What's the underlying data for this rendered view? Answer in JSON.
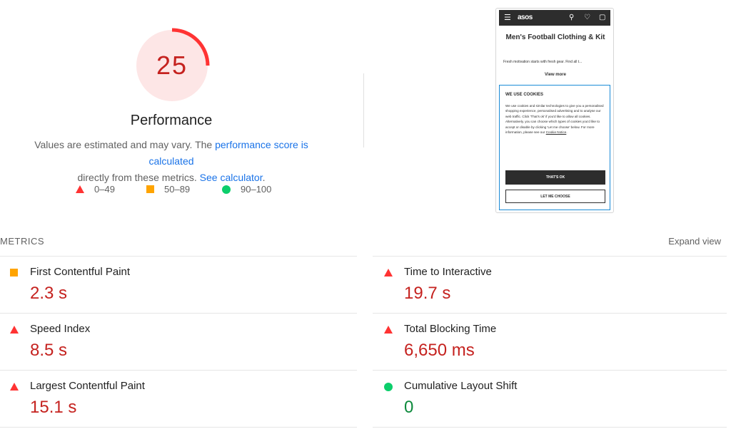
{
  "score": {
    "value": "25",
    "fraction": 0.25,
    "color": "#ff3333",
    "bg": "#fde6e6"
  },
  "performance": {
    "title": "Performance",
    "desc_pre": "Values are estimated and may vary. The ",
    "desc_link1": "performance score is calculated",
    "desc_mid": "directly from these metrics. ",
    "desc_link2": "See calculator",
    "desc_post": "."
  },
  "legend": [
    {
      "shape": "triangle",
      "color": "#ff3333",
      "label": "0–49"
    },
    {
      "shape": "square",
      "color": "#ffa400",
      "label": "50–89"
    },
    {
      "shape": "circle",
      "color": "#0cce6b",
      "label": "90–100"
    }
  ],
  "screenshot": {
    "menu_icon": "☰",
    "logo": "asos",
    "search_icon": "⚲",
    "heart_icon": "♡",
    "bag_icon": "▢",
    "page_title": "Men's Football Clothing & Kit",
    "subtitle": "Fresh motivation starts with fresh gear. Find all t...",
    "view_more": "View more",
    "cookie_heading": "WE USE COOKIES",
    "cookie_body": "We use cookies and similar technologies to give you a personalised shopping experience, personalised advertising and to analyse our web traffic. Click 'That's ok' if you'd like to allow all cookies. Alternatively, you can choose which types of cookies you'd like to accept or disable by clicking 'Let me choose' below. For more information, please see our ",
    "cookie_link": "Cookie Notice",
    "cookie_end": ".",
    "ok_button": "THAT'S OK",
    "choose_button": "LET ME CHOOSE"
  },
  "metrics": {
    "heading": "METRICS",
    "expand": "Expand view",
    "left": [
      {
        "shape": "square",
        "color": "#ffa400",
        "title": "First Contentful Paint",
        "value": "2.3 s",
        "status": "red"
      },
      {
        "shape": "triangle",
        "color": "#ff3333",
        "title": "Speed Index",
        "value": "8.5 s",
        "status": "red"
      },
      {
        "shape": "triangle",
        "color": "#ff3333",
        "title": "Largest Contentful Paint",
        "value": "15.1 s",
        "status": "red"
      }
    ],
    "right": [
      {
        "shape": "triangle",
        "color": "#ff3333",
        "title": "Time to Interactive",
        "value": "19.7 s",
        "status": "red"
      },
      {
        "shape": "triangle",
        "color": "#ff3333",
        "title": "Total Blocking Time",
        "value": "6,650 ms",
        "status": "red"
      },
      {
        "shape": "circle",
        "color": "#0cce6b",
        "title": "Cumulative Layout Shift",
        "value": "0",
        "status": "green"
      }
    ]
  }
}
